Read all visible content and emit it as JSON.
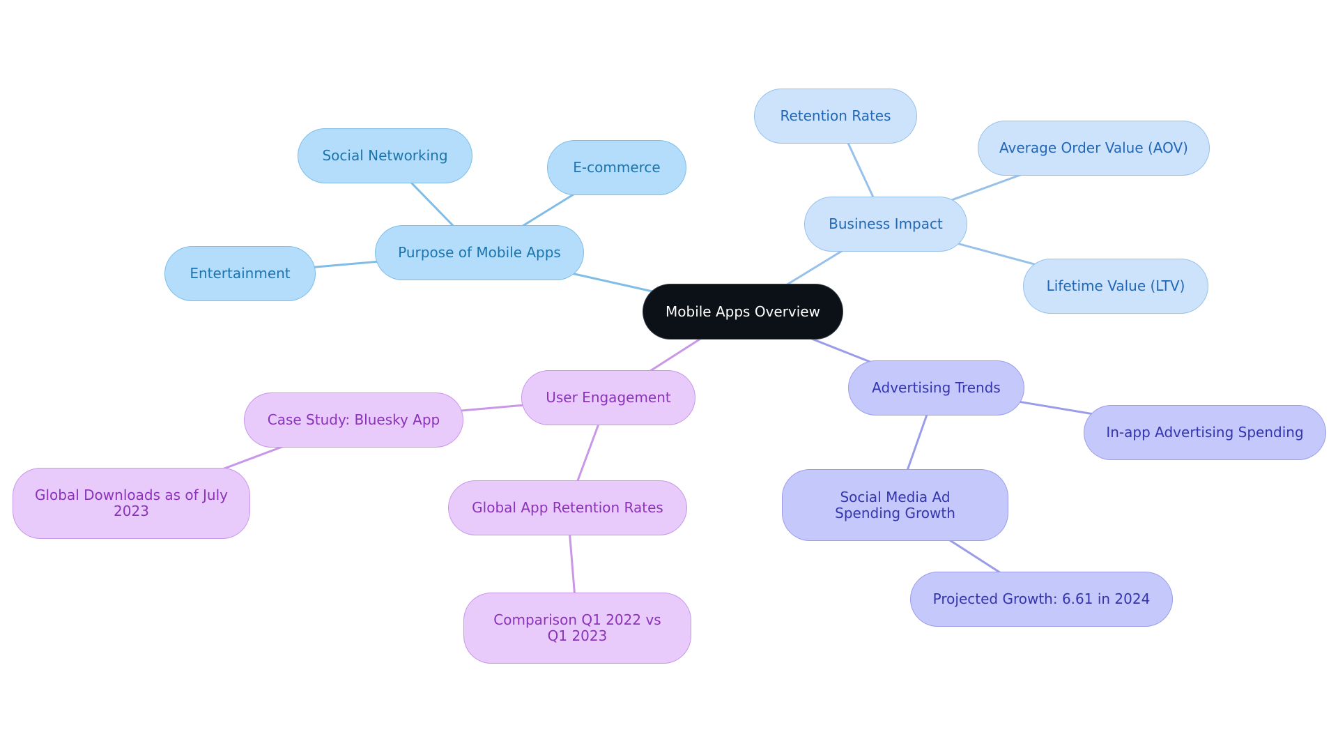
{
  "title": "Mobile Apps Overview",
  "colors": {
    "root_bg": "#0c1118",
    "branch_purpose": "#b3ddfb",
    "branch_business": "#cce3fb",
    "branch_advertising": "#c5c8fb",
    "branch_engagement": "#e8cbfb",
    "edge_purpose": "#7fbde6",
    "edge_business": "#97c1ea",
    "edge_advertising": "#9a9cea",
    "edge_engagement": "#c996e8"
  },
  "nodes": {
    "root": "Mobile Apps Overview",
    "purpose": "Purpose of Mobile Apps",
    "social_networking": "Social Networking",
    "ecommerce": "E-commerce",
    "entertainment": "Entertainment",
    "business": "Business Impact",
    "retention_rates": "Retention Rates",
    "aov": "Average Order Value (AOV)",
    "ltv": "Lifetime Value (LTV)",
    "advertising": "Advertising Trends",
    "inapp": "In-app Advertising Spending",
    "social_media_ad": "Social Media Ad Spending Growth",
    "projected": "Projected Growth: 6.61 in 2024",
    "engagement": "User Engagement",
    "case_study": "Case Study: Bluesky App",
    "global_downloads": "Global Downloads as of July 2023",
    "global_retention": "Global App Retention Rates",
    "comparison": "Comparison Q1 2022 vs Q1 2023"
  },
  "edges": [
    [
      "root",
      "purpose",
      "purpose"
    ],
    [
      "purpose",
      "social_networking",
      "purpose"
    ],
    [
      "purpose",
      "ecommerce",
      "purpose"
    ],
    [
      "purpose",
      "entertainment",
      "purpose"
    ],
    [
      "root",
      "business",
      "business"
    ],
    [
      "business",
      "retention_rates",
      "business"
    ],
    [
      "business",
      "aov",
      "business"
    ],
    [
      "business",
      "ltv",
      "business"
    ],
    [
      "root",
      "advertising",
      "advertising"
    ],
    [
      "advertising",
      "inapp",
      "advertising"
    ],
    [
      "advertising",
      "social_media_ad",
      "advertising"
    ],
    [
      "social_media_ad",
      "projected",
      "advertising"
    ],
    [
      "root",
      "engagement",
      "engagement"
    ],
    [
      "engagement",
      "case_study",
      "engagement"
    ],
    [
      "case_study",
      "global_downloads",
      "engagement"
    ],
    [
      "engagement",
      "global_retention",
      "engagement"
    ],
    [
      "global_retention",
      "comparison",
      "engagement"
    ]
  ]
}
